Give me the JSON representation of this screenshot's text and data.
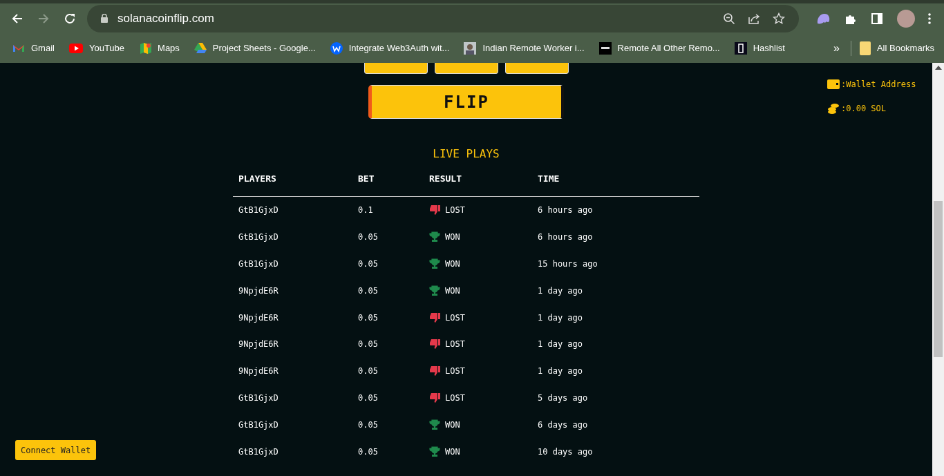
{
  "browser": {
    "url": "solanacoinflip.com",
    "bookmarks": [
      {
        "label": "Gmail",
        "kind": "gmail"
      },
      {
        "label": "YouTube",
        "kind": "youtube"
      },
      {
        "label": "Maps",
        "kind": "maps"
      },
      {
        "label": "Project Sheets - Google...",
        "kind": "drive"
      },
      {
        "label": "Integrate Web3Auth wit...",
        "kind": "letter"
      },
      {
        "label": "Indian Remote Worker i...",
        "kind": "photo"
      },
      {
        "label": "Remote All Other Remo...",
        "kind": "dark"
      },
      {
        "label": "Hashlist",
        "kind": "bracket"
      }
    ],
    "more": "»",
    "all_bookmarks": "All Bookmarks"
  },
  "game": {
    "flip_button": "FLIP"
  },
  "wallet": {
    "address": ":Wallet Address",
    "balance": ":0.00 SOL"
  },
  "live_plays": {
    "title": "LIVE PLAYS",
    "columns": [
      "PLAYERS",
      "BET",
      "RESULT",
      "TIME"
    ],
    "rows": [
      {
        "player": "GtB1GjxD",
        "bet": "0.1",
        "result": "LOST",
        "kind": "lost",
        "time": "6 hours ago"
      },
      {
        "player": "GtB1GjxD",
        "bet": "0.05",
        "result": "WON",
        "kind": "won",
        "time": "6 hours ago"
      },
      {
        "player": "GtB1GjxD",
        "bet": "0.05",
        "result": "WON",
        "kind": "won",
        "time": "15 hours ago"
      },
      {
        "player": "9NpjdE6R",
        "bet": "0.05",
        "result": "WON",
        "kind": "won",
        "time": "1 day ago"
      },
      {
        "player": "9NpjdE6R",
        "bet": "0.05",
        "result": "LOST",
        "kind": "lost",
        "time": "1 day ago"
      },
      {
        "player": "9NpjdE6R",
        "bet": "0.05",
        "result": "LOST",
        "kind": "lost",
        "time": "1 day ago"
      },
      {
        "player": "9NpjdE6R",
        "bet": "0.05",
        "result": "LOST",
        "kind": "lost",
        "time": "1 day ago"
      },
      {
        "player": "GtB1GjxD",
        "bet": "0.05",
        "result": "LOST",
        "kind": "lost",
        "time": "5 days ago"
      },
      {
        "player": "GtB1GjxD",
        "bet": "0.05",
        "result": "WON",
        "kind": "won",
        "time": "6 days ago"
      },
      {
        "player": "GtB1GjxD",
        "bet": "0.05",
        "result": "WON",
        "kind": "won",
        "time": "10 days ago"
      }
    ]
  },
  "connect_button": "Connect Wallet"
}
